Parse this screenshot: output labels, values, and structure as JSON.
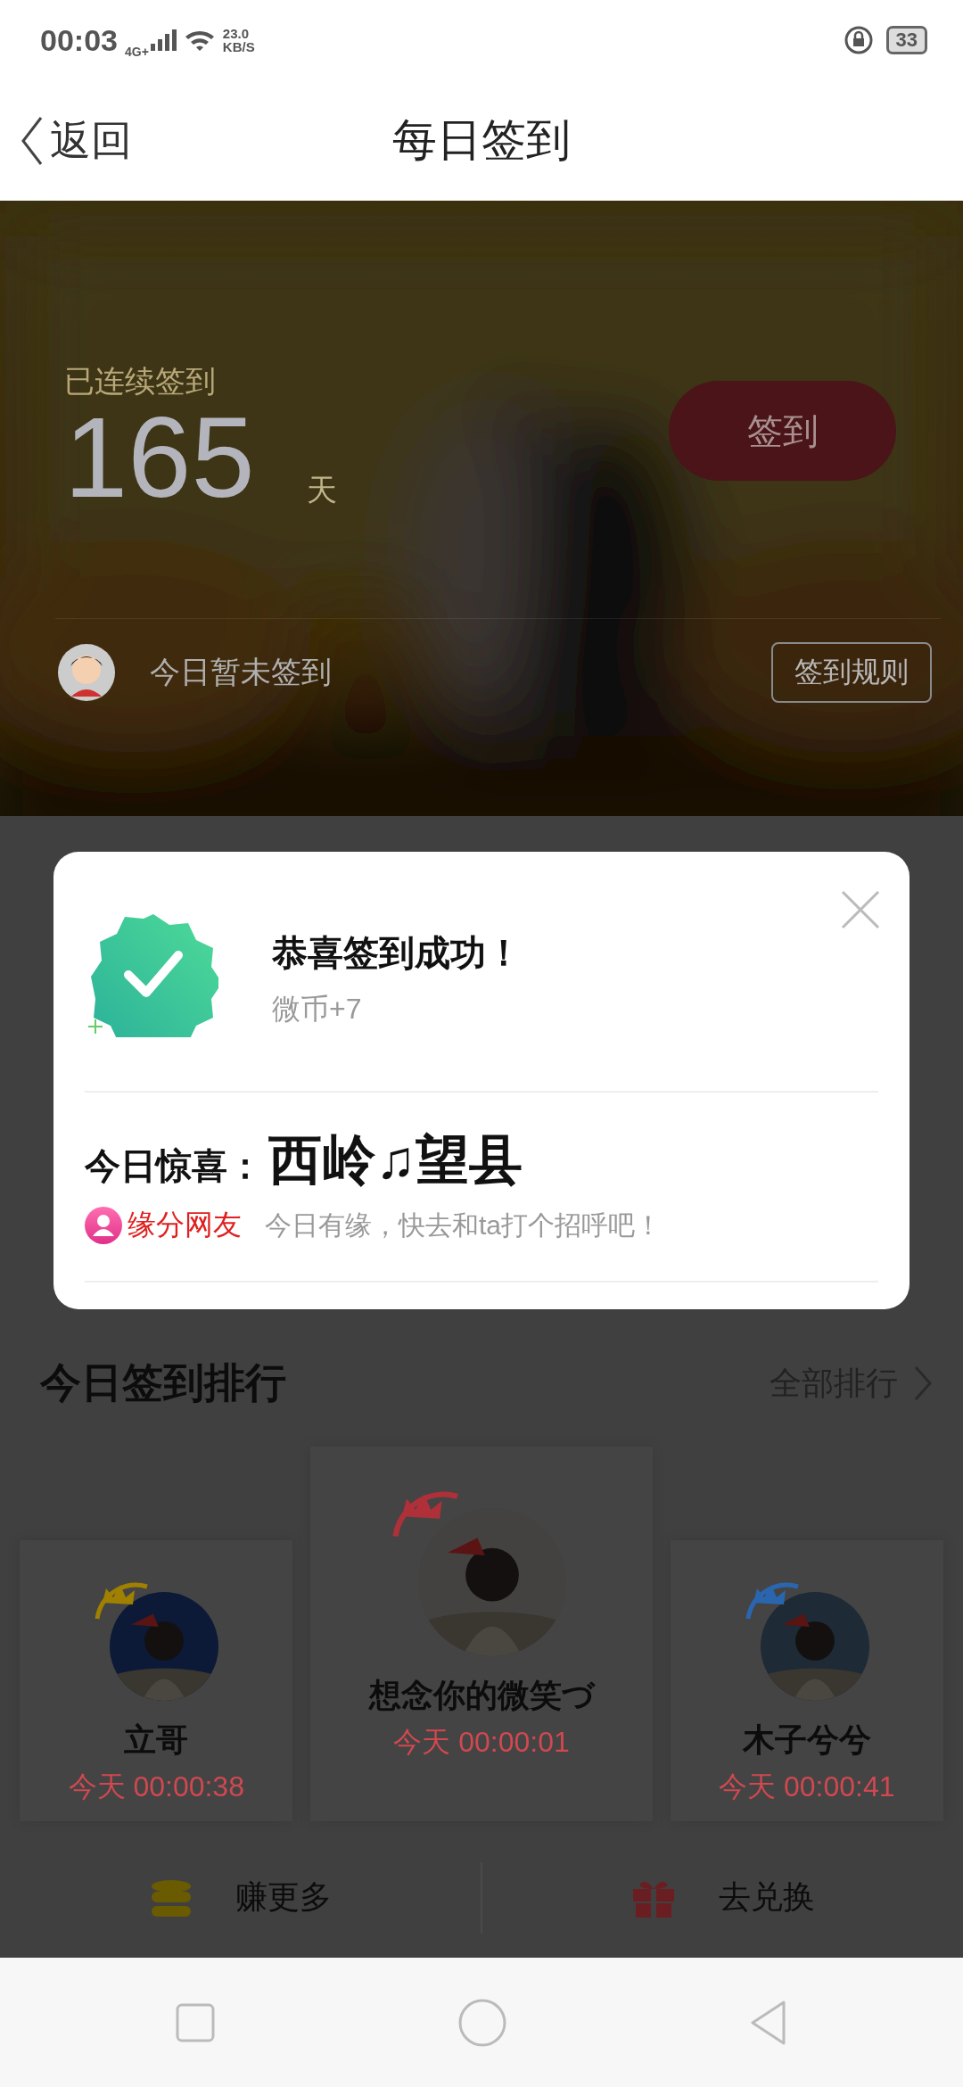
{
  "status_bar": {
    "time": "00:03",
    "network": "4G+",
    "speed_value": "23.0",
    "speed_unit": "KB/S",
    "battery": "33"
  },
  "nav": {
    "back": "返回",
    "title": "每日签到"
  },
  "header": {
    "streak_label": "已连续签到",
    "streak_days": "165",
    "unit": "天",
    "sign_button": "签到",
    "status": "今日暂未签到",
    "rules_button": "签到规则"
  },
  "ranking": {
    "title": "今日签到排行",
    "more": "全部排行",
    "entries": [
      {
        "name": "立哥",
        "time": "今天 00:00:38",
        "color": "#a08000",
        "raised": false
      },
      {
        "name": "想念你的微笑づ",
        "time": "今天 00:00:01",
        "color": "#b0303a",
        "raised": true
      },
      {
        "name": "木子兮兮",
        "time": "今天 00:00:41",
        "color": "#2a66b0",
        "raised": false
      }
    ]
  },
  "actions": [
    {
      "kind": "coins",
      "label": "赚更多"
    },
    {
      "kind": "gift",
      "label": "去兑换"
    }
  ],
  "dialog": {
    "title": "恭喜签到成功！",
    "reward": "微币+7",
    "surprise_label": "今日惊喜：",
    "surprise_value": "西岭♫望县",
    "tag": "缘分网友",
    "message": "今日有缘，快去和ta打个招呼吧！"
  }
}
